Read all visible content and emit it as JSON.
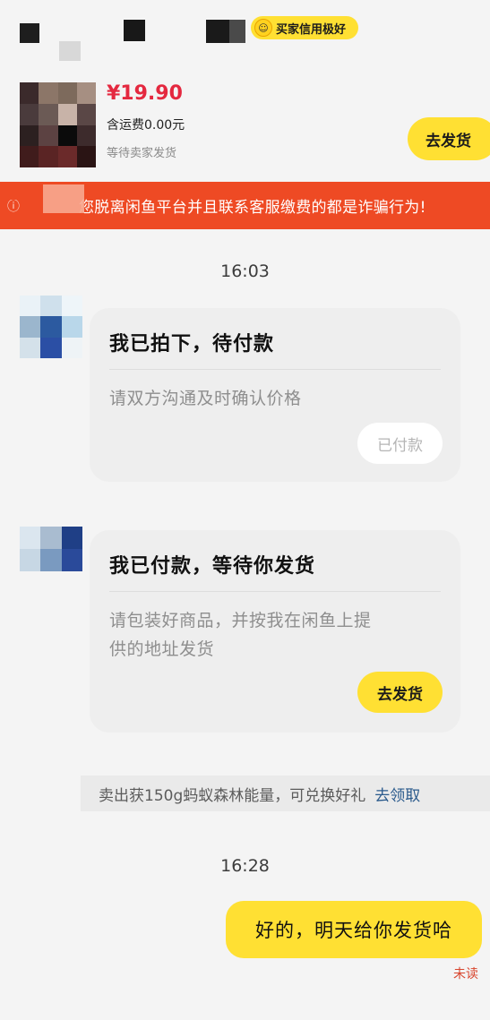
{
  "header": {
    "credit_badge": "买家信用极好",
    "credit_icon": "smile-face-icon"
  },
  "order": {
    "price": "¥19.90",
    "shipping": "含运费0.00元",
    "status": "等待卖家发货",
    "ship_button": "去发货"
  },
  "warning": {
    "text": "您脱离闲鱼平台并且联系客服缴费的都是诈骗行为!",
    "icon": "info-circle-icon",
    "color": "#ee4a24"
  },
  "messages": [
    {
      "time": "16:03",
      "title": "我已拍下，待付款",
      "body": "请双方沟通及时确认价格",
      "button": "已付款"
    },
    {
      "title": "我已付款，等待你发货",
      "body_lines": [
        "请包装好商品，并按我在闲鱼上提",
        "供的地址发货"
      ],
      "button": "去发货"
    }
  ],
  "energy_notice": {
    "text": "卖出获150g蚂蚁森林能量，可兑换好礼",
    "link": "去领取"
  },
  "reply": {
    "time": "16:28",
    "text": "好的，明天给你发货哈",
    "read_status": "未读"
  },
  "colors": {
    "accent_yellow": "#ffe033",
    "price_red": "#e4283f",
    "background": "#f4f4f4"
  }
}
